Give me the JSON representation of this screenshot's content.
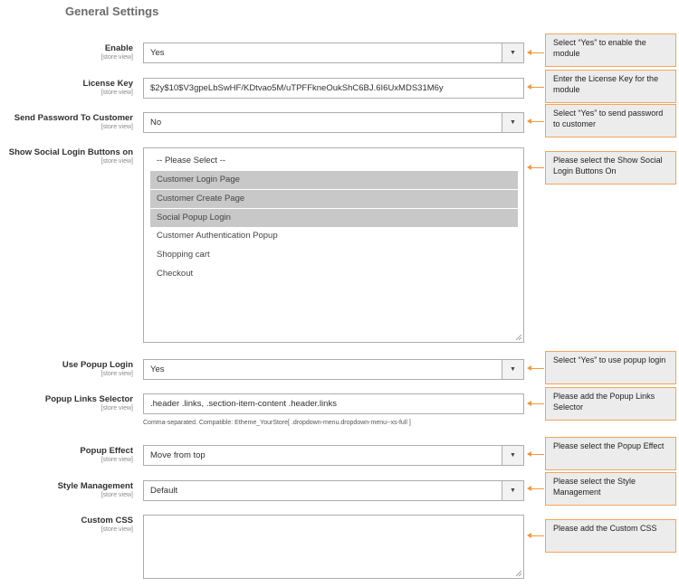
{
  "section_title": "General Settings",
  "scope_label": "[store view]",
  "fields": {
    "enable": {
      "label": "Enable",
      "value": "Yes"
    },
    "license_key": {
      "label": "License Key",
      "value": "$2y$10$V3gpeLbSwHF/KDtvao5M/uTPFFkneOukShC6BJ.6I6UxMDS31M6y"
    },
    "send_password": {
      "label": "Send Password To Customer",
      "value": "No"
    },
    "social_buttons": {
      "label": "Show Social Login Buttons on",
      "placeholder": "-- Please Select --",
      "options": [
        {
          "label": "Customer Login Page",
          "selected": true
        },
        {
          "label": "Customer Create Page",
          "selected": true
        },
        {
          "label": "Social Popup Login",
          "selected": true
        },
        {
          "label": "Customer Authentication Popup",
          "selected": false
        },
        {
          "label": "Shopping cart",
          "selected": false
        },
        {
          "label": "Checkout",
          "selected": false
        }
      ]
    },
    "use_popup": {
      "label": "Use Popup Login",
      "value": "Yes"
    },
    "popup_links": {
      "label": "Popup Links Selector",
      "value": ".header .links, .section-item-content .header.links",
      "note": "Comma-separated. Compatible: Etheme_YourStore[ .dropdown-menu.dropdown-menu--xs-full ]"
    },
    "popup_effect": {
      "label": "Popup Effect",
      "value": "Move from top"
    },
    "style_management": {
      "label": "Style Management",
      "value": "Default"
    },
    "custom_css": {
      "label": "Custom CSS",
      "value": ""
    }
  },
  "callouts": {
    "enable": "Select “Yes” to enable the module",
    "license_key": "Enter the License Key for the module",
    "send_password": "Select “Yes” to send password to customer",
    "social_buttons": "Please select the Show Social Login Buttons On",
    "use_popup": "Select “Yes” to use popup login",
    "popup_links": "Please add the Popup Links Selector",
    "popup_effect": "Please select the Popup Effect",
    "style_management": "Please select the Style Management",
    "custom_css": "Please add the Custom CSS"
  },
  "icons": {
    "dropdown": "dropdown-arrow-icon",
    "resize": "resize-grip-icon",
    "pointer": "arrow-left-icon"
  },
  "colors": {
    "callout_border": "#f2a559",
    "callout_bg": "#ececec",
    "selected_option": "#c8c8c8",
    "arrow": "#f0993c"
  }
}
